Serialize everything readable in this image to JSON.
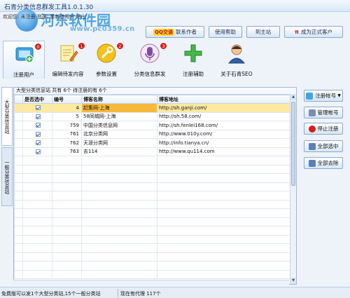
{
  "window": {
    "title": "石青分类信息群发工具1.0.1.30",
    "watermark_title": "河东软件园",
    "watermark_url": "www.pc0359.cn"
  },
  "userbar": {
    "text": "欢迎您: 未注册 登录: 重新选用户 退出"
  },
  "top_buttons": {
    "qq_badge": "QQ交谈",
    "contact_author": "联系作者",
    "help": "使用帮助",
    "home": "到主站",
    "become_member": "成为正式客户"
  },
  "toolbar": {
    "items": [
      {
        "label": "注册用户",
        "icon": "register-user-icon",
        "badge": "0"
      },
      {
        "label": "编辑待发内容",
        "icon": "edit-content-icon",
        "badge": "1"
      },
      {
        "label": "参数设置",
        "icon": "settings-icon",
        "badge": "2"
      },
      {
        "label": "分类信息群发",
        "icon": "broadcast-icon",
        "badge": "3"
      },
      {
        "label": "注册辅助",
        "icon": "register-assist-icon",
        "badge": ""
      },
      {
        "label": "关于石青SEO",
        "icon": "about-icon",
        "badge": ""
      }
    ]
  },
  "vertical_tabs": [
    "大型分类信息站",
    "一般分类信息站"
  ],
  "panel": {
    "header": "大型分类信息站 共有 6个 待注册的有 6个",
    "columns": [
      "是否选中",
      "编号",
      "博客名称",
      "博客地址"
    ],
    "rows": [
      {
        "checked": true,
        "id": "4",
        "name": "赶集网-上海",
        "url": "http://sh.ganji.com/",
        "selected": true
      },
      {
        "checked": true,
        "id": "5",
        "name": "58同城网-上海",
        "url": "http://sh.58.com/",
        "selected": false
      },
      {
        "checked": true,
        "id": "759",
        "name": "中国分类信息网",
        "url": "http://sh.fenlei168.com/",
        "selected": false
      },
      {
        "checked": true,
        "id": "761",
        "name": "北京分类网",
        "url": "http://www.010y.com/",
        "selected": false
      },
      {
        "checked": true,
        "id": "762",
        "name": "天涯分类网",
        "url": "http://info.tianya.cn/",
        "selected": false
      },
      {
        "checked": true,
        "id": "763",
        "name": "去114",
        "url": "http://www.qu114.com",
        "selected": false
      }
    ]
  },
  "side_buttons": {
    "register_account": "注册帐号",
    "manage_account": "管理帐号",
    "stop_register": "停止注册",
    "select_all": "全部选中",
    "deselect_all": "全部去除"
  },
  "statusbar": {
    "left": "免费版可以发1个大型分类站,15个一般分类站",
    "right": "现在有代理 117个"
  },
  "colors": {
    "accent": "#3c9ae0",
    "badge": "#d81b1b",
    "selected_row": "#fde9a0"
  }
}
